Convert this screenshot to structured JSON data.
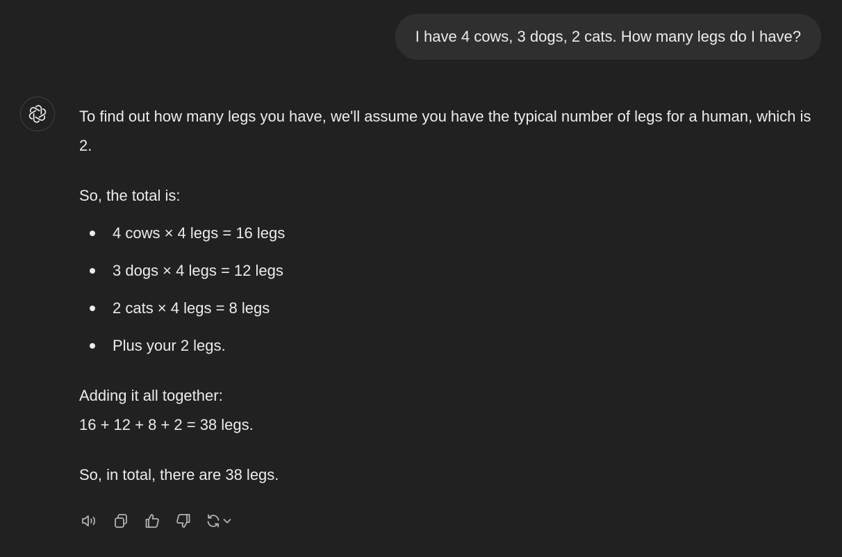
{
  "user_message": {
    "text": "I have 4 cows, 3 dogs, 2 cats. How many legs do I have?"
  },
  "assistant": {
    "avatar_icon": "openai-logo-icon",
    "intro": "To find out how many legs you have, we'll assume you have the typical number of legs for a human, which is 2.",
    "total_intro": "So, the total is:",
    "bullets": [
      "4 cows × 4 legs = 16 legs",
      "3 dogs × 4 legs = 12 legs",
      "2 cats × 4 legs = 8 legs",
      "Plus your 2 legs."
    ],
    "adding_line": "Adding it all together:",
    "sum_line": "16 + 12 + 8 + 2 = 38 legs.",
    "conclusion": "So, in total, there are 38 legs."
  },
  "actions": [
    {
      "icon": "speaker-icon"
    },
    {
      "icon": "copy-icon"
    },
    {
      "icon": "thumbs-up-icon"
    },
    {
      "icon": "thumbs-down-icon"
    },
    {
      "icon": "regenerate-icon"
    },
    {
      "icon": "chevron-down-icon"
    }
  ],
  "colors": {
    "background": "#212121",
    "user_bubble": "#2f2f2f",
    "text": "#ececec",
    "icon": "#b4b4b4"
  }
}
